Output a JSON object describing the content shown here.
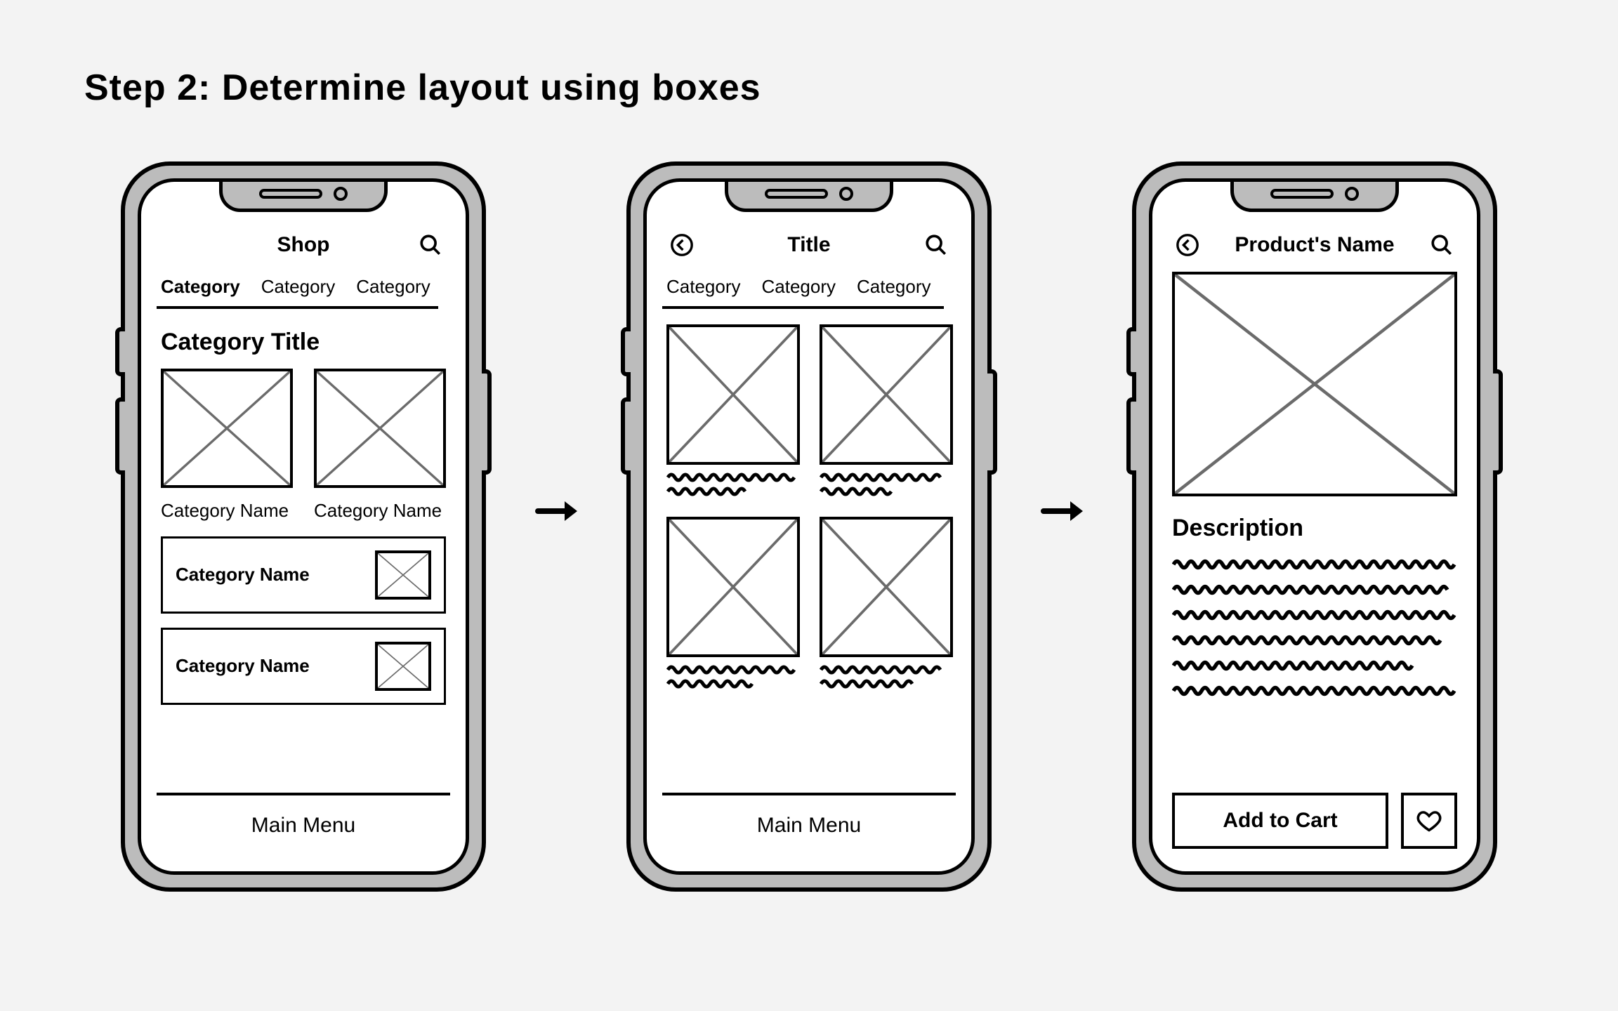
{
  "page_title": "Step 2: Determine layout using boxes",
  "screens": {
    "shop": {
      "header": {
        "title": "Shop"
      },
      "tabs": [
        "Category",
        "Category",
        "Category"
      ],
      "active_tab": 0,
      "section_title": "Category Title",
      "cards": [
        {
          "label": "Category Name"
        },
        {
          "label": "Category Name"
        }
      ],
      "list": [
        {
          "label": "Category Name"
        },
        {
          "label": "Category Name"
        }
      ],
      "footer": "Main Menu"
    },
    "listing": {
      "header": {
        "title": "Title"
      },
      "tabs": [
        "Category",
        "Category",
        "Category"
      ],
      "footer": "Main Menu"
    },
    "product": {
      "header": {
        "title": "Product's Name"
      },
      "description_heading": "Description",
      "cta_label": "Add to Cart"
    }
  }
}
